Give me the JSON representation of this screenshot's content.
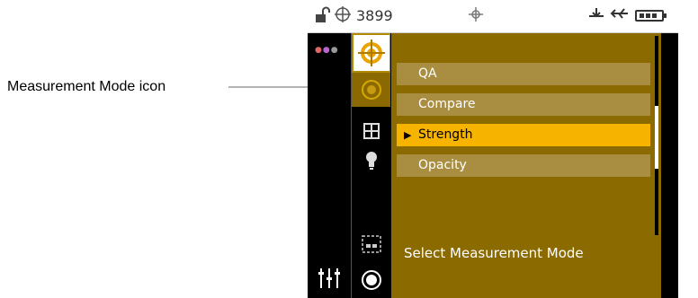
{
  "callout": {
    "label": "Measurement Mode icon"
  },
  "status_bar": {
    "lock_icon": "unlock-icon",
    "target_icon": "target-icon",
    "value": "3899",
    "crosshair_icon": "crosshair-icon",
    "stand_icon": "stand-icon",
    "usb_icon": "usb-icon",
    "battery_icon": "battery-icon"
  },
  "sidebar": {
    "left_icons": [
      "color-dots-icon",
      "adjust-icon"
    ],
    "icons": [
      "target-icon",
      "measurement-mode-icon",
      "view-icon",
      "bulb-icon",
      "dash-box-icon",
      "measure-button-icon"
    ]
  },
  "menu": {
    "items": [
      {
        "label": "QA"
      },
      {
        "label": "Compare"
      },
      {
        "label": "Strength",
        "selected": true
      },
      {
        "label": "Opacity"
      }
    ],
    "hint": "Select Measurement Mode"
  },
  "colors": {
    "panel_bg": "#8b6a00",
    "item_bg": "#a98d41",
    "selected_bg": "#f6b400",
    "arrow": "#b3b3b3"
  }
}
